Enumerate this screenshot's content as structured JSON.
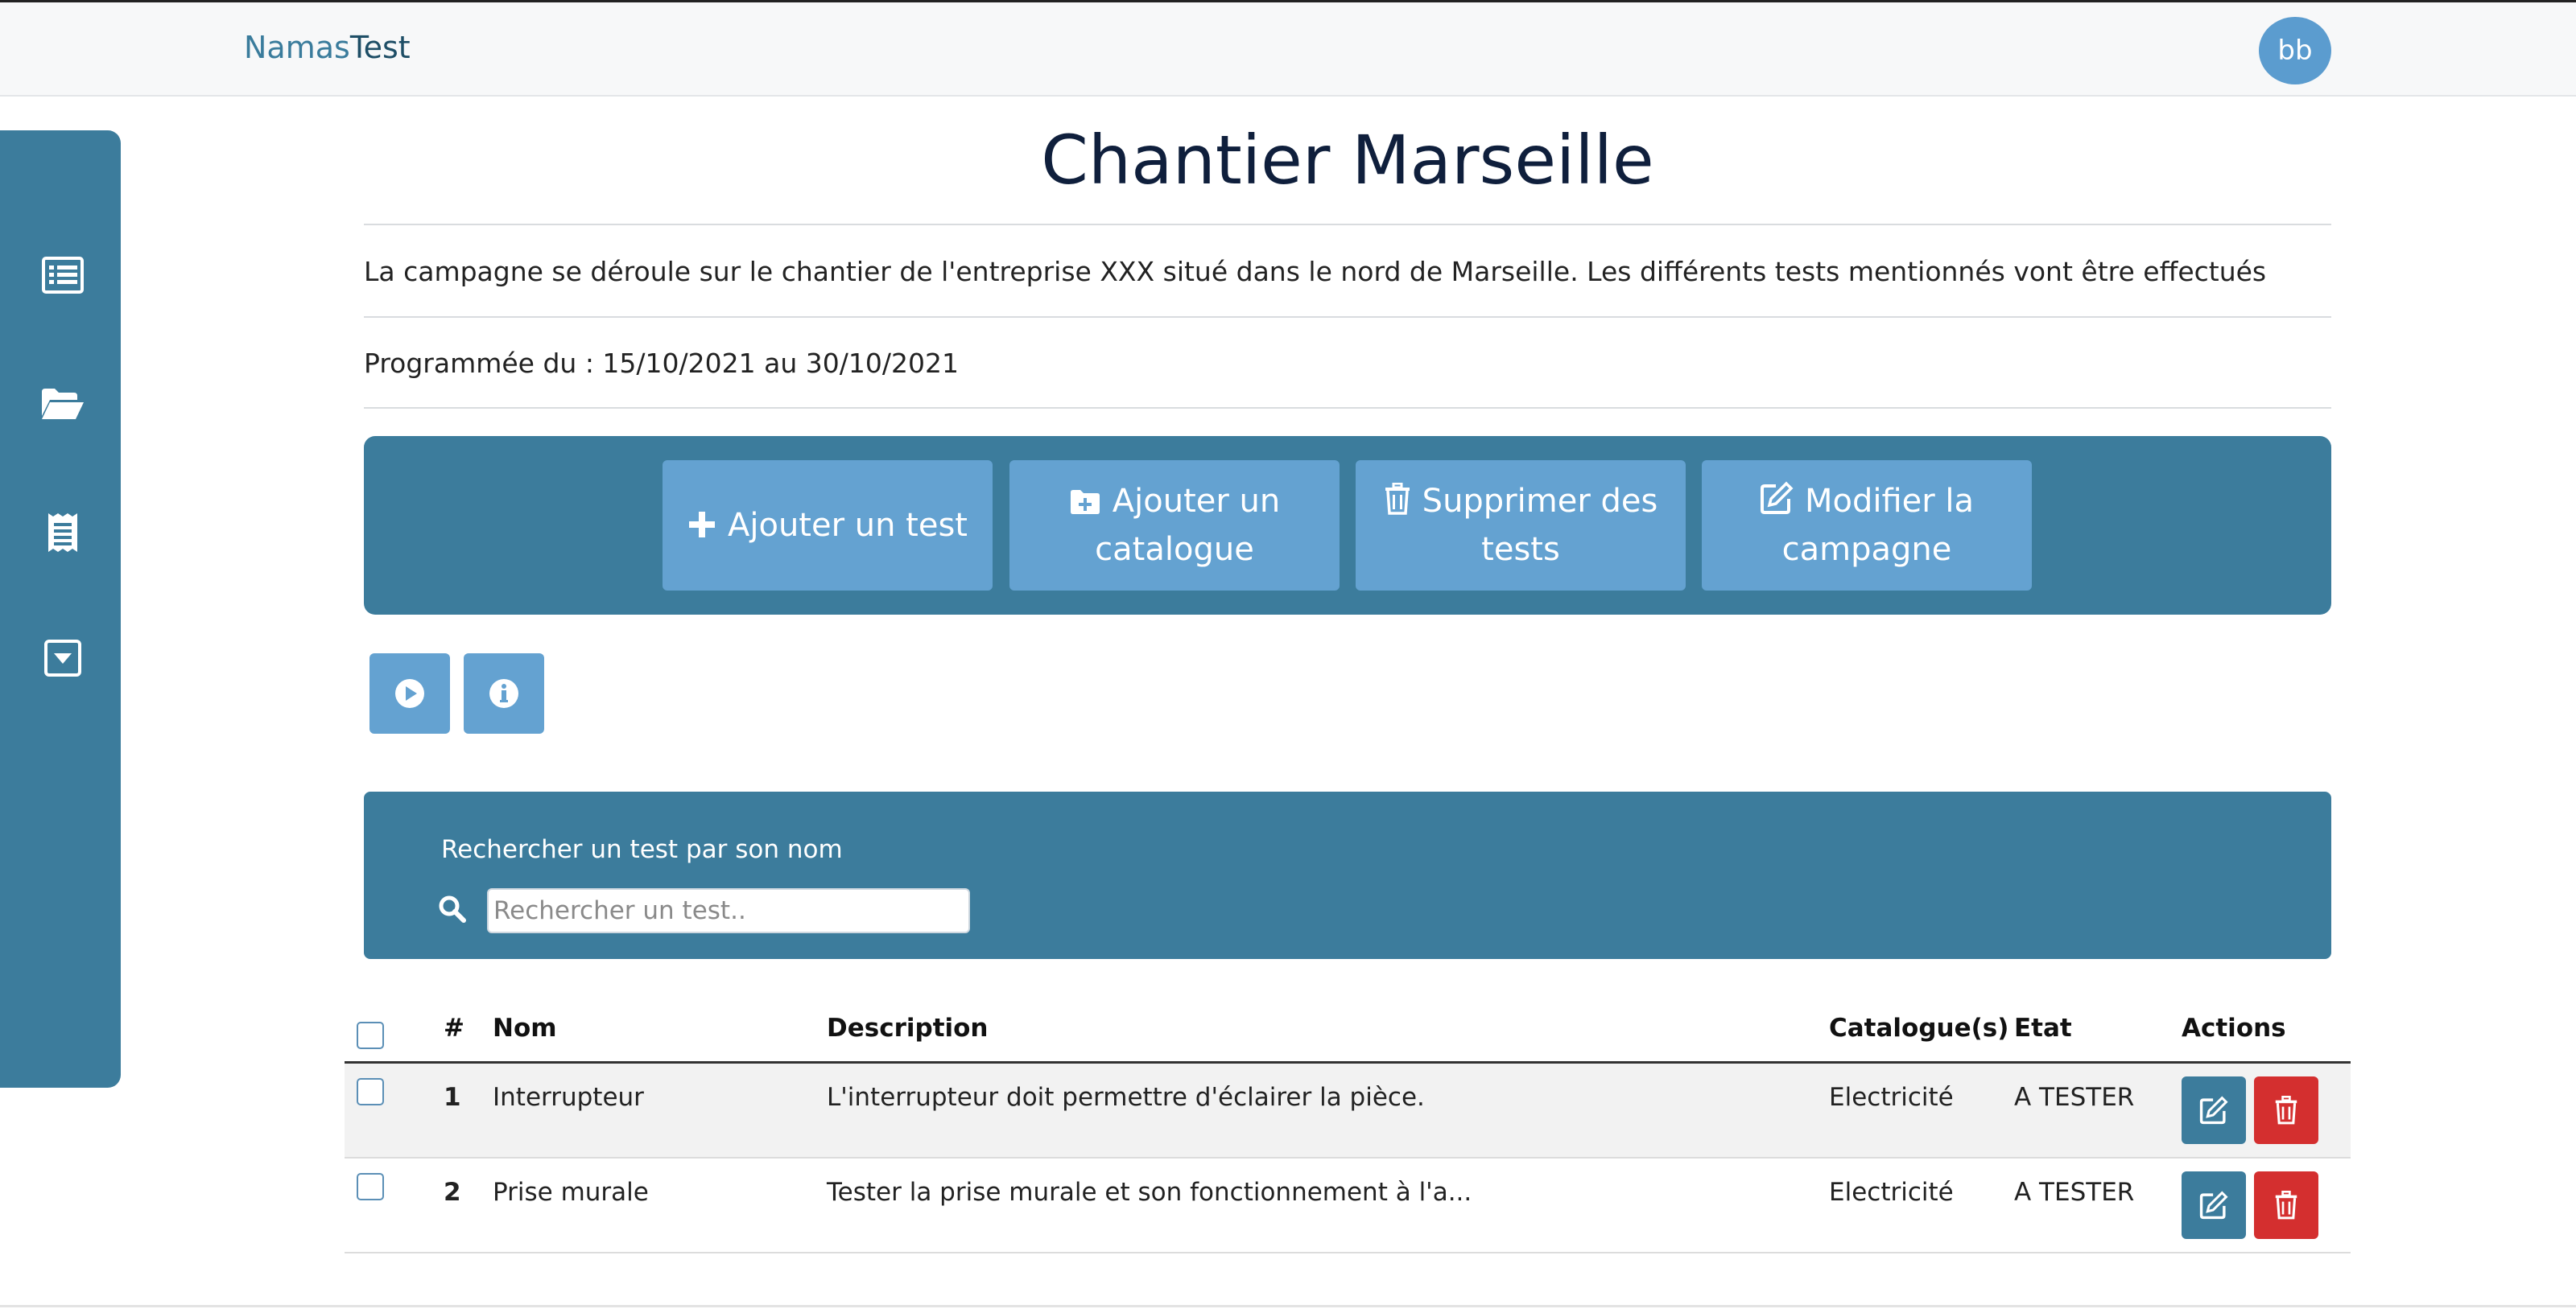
{
  "header": {
    "brand_part1": "Namas",
    "brand_part2": "Test",
    "avatar_initials": "bb"
  },
  "sidebar": {
    "items": [
      {
        "icon": "list-icon"
      },
      {
        "icon": "folder-open-icon"
      },
      {
        "icon": "receipt-icon"
      },
      {
        "icon": "caret-square-down-icon"
      }
    ]
  },
  "campaign": {
    "title": "Chantier Marseille",
    "description": "La campagne se déroule sur le chantier de l'entreprise XXX situé dans le nord de Marseille. Les différents tests mentionnés vont être effectués",
    "dates": "Programmée du : 15/10/2021 au 30/10/2021"
  },
  "actions": {
    "add_test": "Ajouter un test",
    "add_catalogue_line1": "Ajouter un",
    "add_catalogue_line2": "catalogue",
    "delete_tests_line1": "Supprimer des",
    "delete_tests_line2": "tests",
    "edit_campaign_line1": "Modifier la",
    "edit_campaign_line2": "campagne"
  },
  "secondary_actions": {
    "play_icon": "play-circle-icon",
    "info_icon": "info-circle-icon"
  },
  "search": {
    "label": "Rechercher un test par son nom",
    "placeholder": "Rechercher un test..",
    "value": ""
  },
  "table": {
    "headers": {
      "num": "#",
      "name": "Nom",
      "description": "Description",
      "catalogues": "Catalogue(s)",
      "state": "Etat",
      "actions": "Actions"
    },
    "rows": [
      {
        "num": "1",
        "name": "Interrupteur",
        "description": "L'interrupteur doit permettre d'éclairer la pièce.",
        "catalogue": "Electricité",
        "state": "A TESTER"
      },
      {
        "num": "2",
        "name": "Prise murale",
        "description": "Tester la prise murale et son fonctionnement à l'a...",
        "catalogue": "Electricité",
        "state": "A TESTER"
      }
    ]
  },
  "colors": {
    "primary": "#3c7c9c",
    "button": "#64a2d1",
    "danger": "#d42f2f",
    "title": "#0f1f3c"
  }
}
